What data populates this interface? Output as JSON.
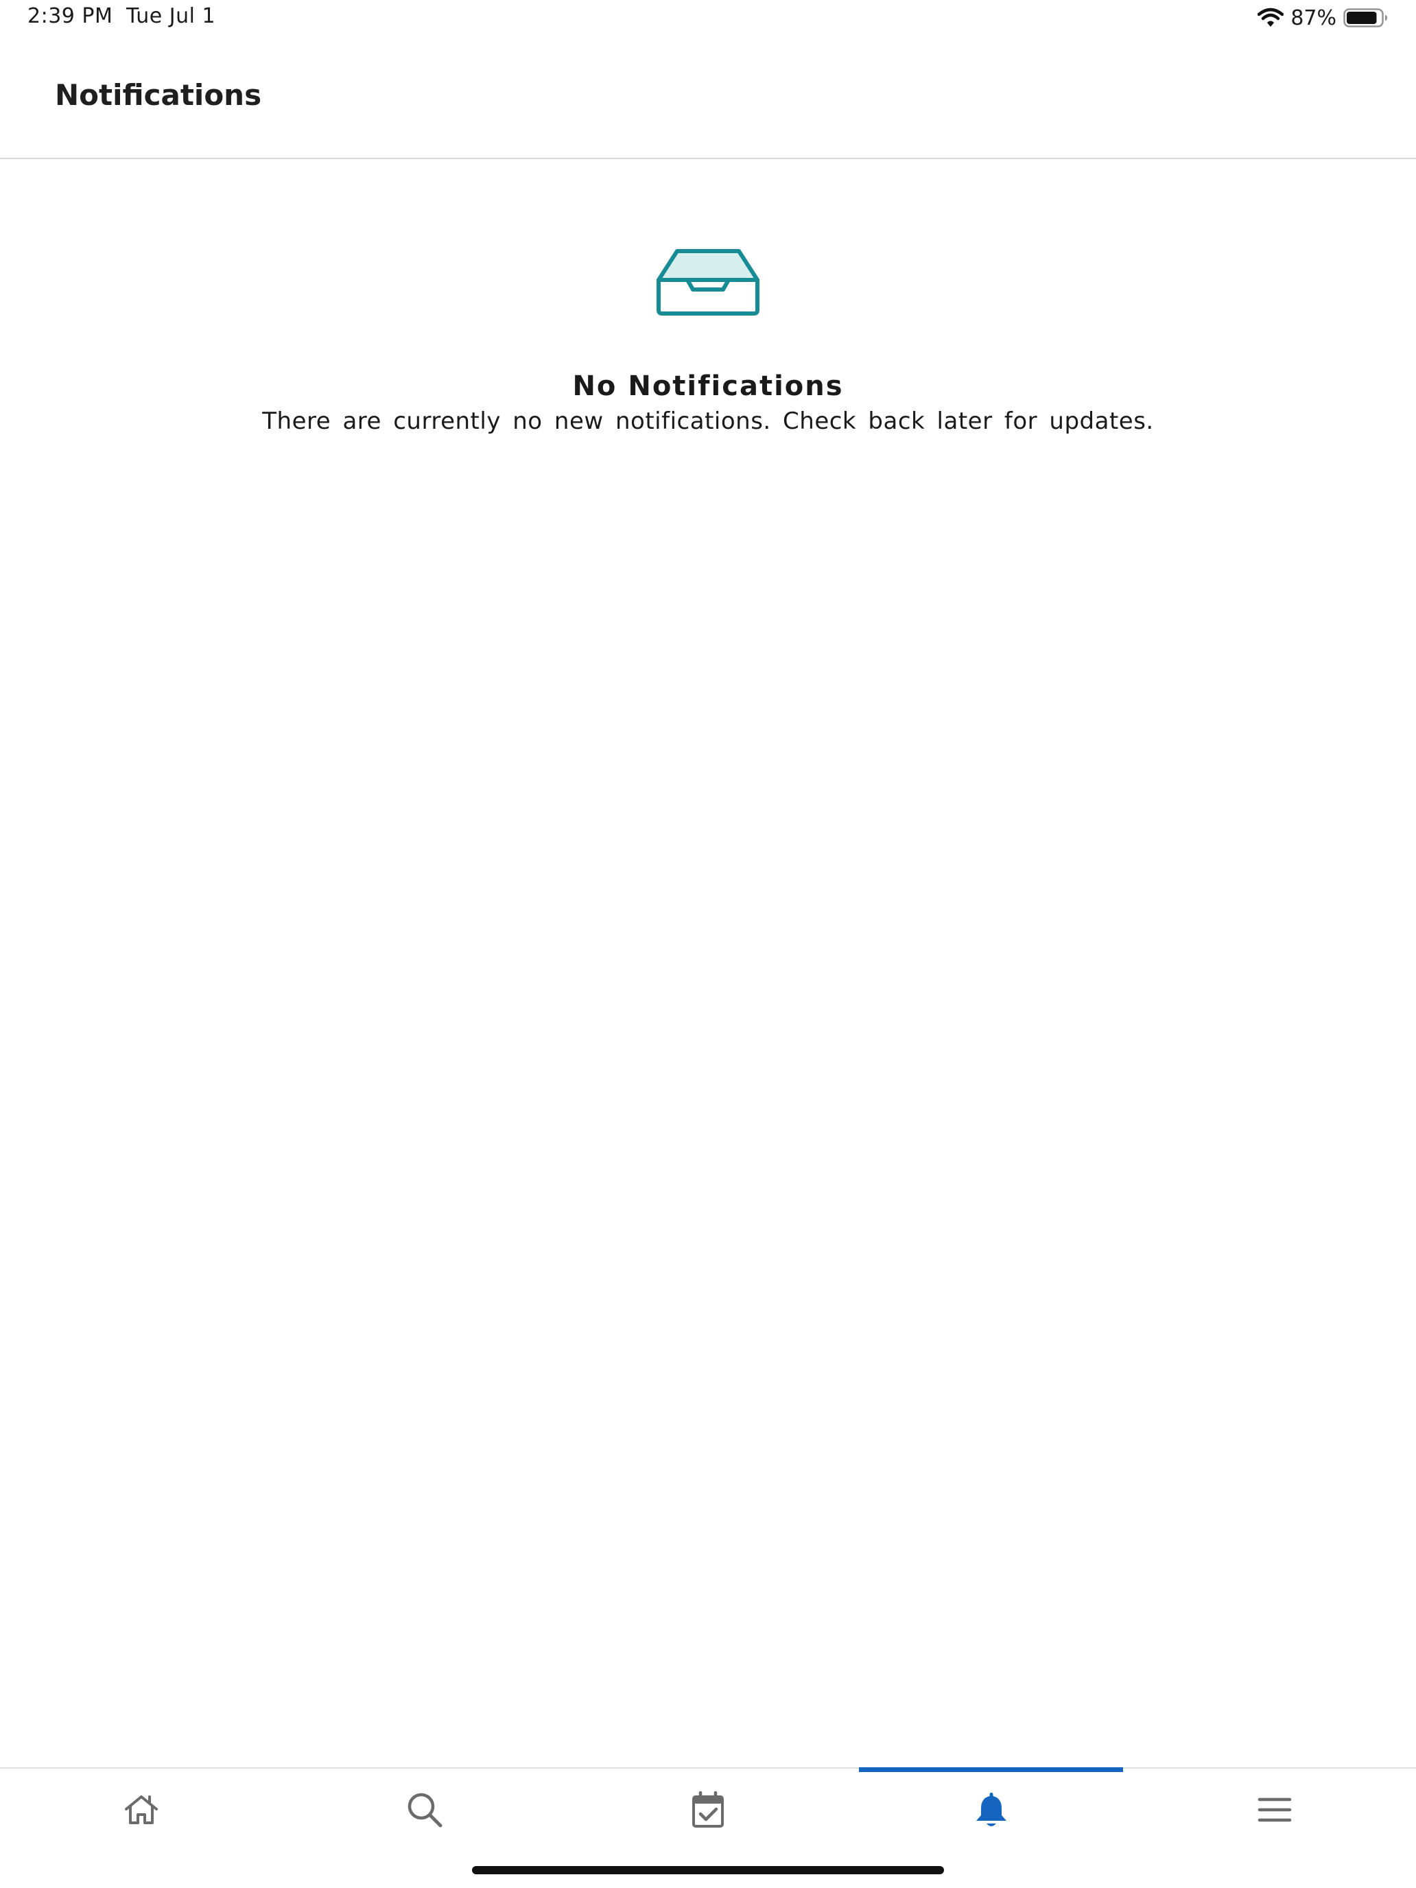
{
  "status_bar": {
    "time": "2:39 PM",
    "date": "Tue Jul 1",
    "battery_percent": "87%",
    "battery_level": 0.87
  },
  "header": {
    "title": "Notifications"
  },
  "empty_state": {
    "icon": "inbox-tray-icon",
    "title": "No Notifications",
    "message": "There are currently no new notifications. Check back later for updates."
  },
  "tab_bar": {
    "active_tab": "notifications",
    "tabs": [
      {
        "id": "home",
        "icon": "home-icon"
      },
      {
        "id": "search",
        "icon": "search-icon"
      },
      {
        "id": "tasks",
        "icon": "calendar-check-icon"
      },
      {
        "id": "notifications",
        "icon": "bell-icon"
      },
      {
        "id": "menu",
        "icon": "hamburger-menu-icon"
      }
    ]
  },
  "colors": {
    "accent": "#1565c0",
    "icon_teal": "#178c94",
    "icon_teal_fill": "#d8eff0",
    "inactive_icon": "#6b6b6b"
  }
}
